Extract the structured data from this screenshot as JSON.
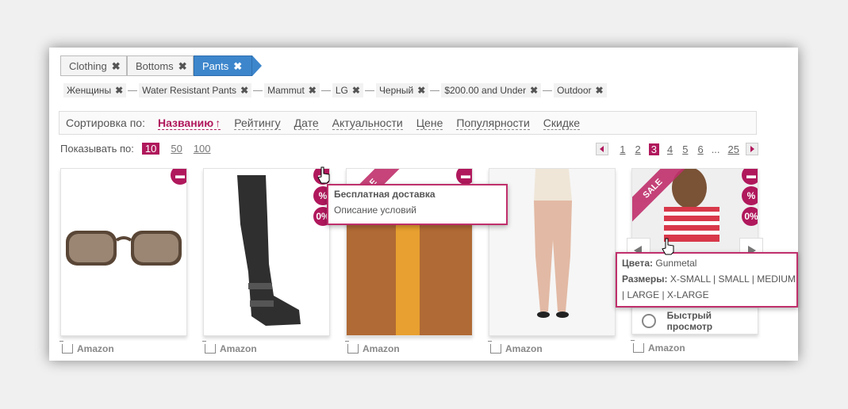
{
  "breadcrumb": [
    {
      "label": "Clothing"
    },
    {
      "label": "Bottoms"
    },
    {
      "label": "Pants"
    }
  ],
  "crumb_close": "✖",
  "filters": [
    "Женщины",
    "Water Resistant Pants",
    "Mammut",
    "LG",
    "Черный",
    "$200.00 and Under",
    "Outdoor"
  ],
  "sort": {
    "label": "Сортировка по:",
    "selected_arrow": "↑",
    "options": [
      "Названию",
      "Рейтингу",
      "Дате",
      "Актуальности",
      "Цене",
      "Популярности",
      "Скидке"
    ]
  },
  "per_page": {
    "label": "Показывать по:",
    "options": [
      "10",
      "50",
      "100"
    ]
  },
  "pagination": {
    "pages": [
      "1",
      "2",
      "3",
      "4",
      "5",
      "6"
    ],
    "ellipsis": "...",
    "last": "25",
    "current": "3"
  },
  "products": [
    {
      "shop": "Amazon",
      "icon": "sunglasses"
    },
    {
      "shop": "Amazon",
      "icon": "boot"
    },
    {
      "shop": "Amazon",
      "icon": "clutch-bag"
    },
    {
      "shop": "Amazon",
      "icon": "pants"
    },
    {
      "shop": "Amazon",
      "icon": "striped-top"
    }
  ],
  "badges": {
    "percent": "%",
    "zero_percent": "0%"
  },
  "sale_label": "SALE",
  "delivery_tooltip": {
    "title": "Бесплатная доставка",
    "desc": "Описание условий"
  },
  "info_tooltip": {
    "colors_label": "Цвета:",
    "colors_value": "Gunmetal",
    "sizes_label": "Размеры:",
    "sizes_line1": "X-SMALL | SMALL | MEDIUM",
    "sizes_line2": "| LARGE | X-LARGE"
  },
  "quick_view": "Быстрый просмотр",
  "colors": {
    "accent": "#b0185c",
    "active_crumb": "#3d86cc"
  }
}
